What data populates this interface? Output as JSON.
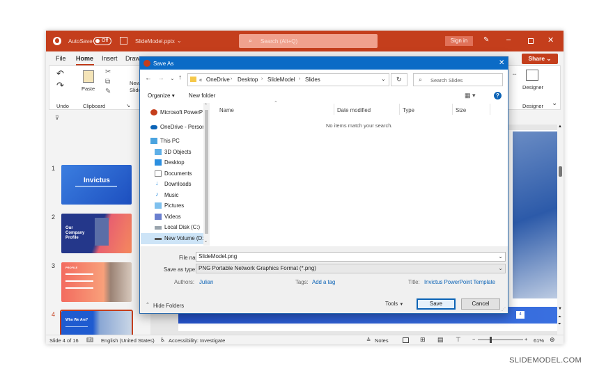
{
  "titlebar": {
    "autosave": "AutoSave",
    "toggle": "Off",
    "filename": "SlideModel.pptx",
    "search_placeholder": "Search (Alt+Q)",
    "signin": "Sign in"
  },
  "tabs": [
    "File",
    "Home",
    "Insert",
    "Draw"
  ],
  "share": "Share",
  "ribbon": {
    "undo": "Undo",
    "clipboard": "Clipboard",
    "paste": "Paste",
    "new_slide_1": "New",
    "new_slide_2": "Slide",
    "designer": "Designer",
    "designer_group": "Designer"
  },
  "slides": [
    {
      "num": "1",
      "title": "Invictus"
    },
    {
      "num": "2",
      "title": "Our Company Profile"
    },
    {
      "num": "3",
      "title": "PROFILE"
    },
    {
      "num": "4",
      "title": "Who We Are?"
    },
    {
      "num": "5",
      "title": ""
    }
  ],
  "status": {
    "slide": "Slide 4 of 16",
    "language": "English (United States)",
    "accessibility": "Accessibility: Investigate",
    "notes": "Notes",
    "zoom": "61%"
  },
  "slide_badge": "4",
  "dialog": {
    "title": "Save As",
    "breadcrumb": [
      "OneDrive",
      "Desktop",
      "SlideModel",
      "Slides"
    ],
    "breadcrumb_prefix": "«",
    "search_placeholder": "Search Slides",
    "organize": "Organize",
    "new_folder": "New folder",
    "tree": [
      "Microsoft PowerP",
      "OneDrive - Person",
      "This PC",
      "3D Objects",
      "Desktop",
      "Documents",
      "Downloads",
      "Music",
      "Pictures",
      "Videos",
      "Local Disk (C:)",
      "New Volume (D:"
    ],
    "columns": [
      "Name",
      "Date modified",
      "Type",
      "Size"
    ],
    "empty_message": "No items match your search.",
    "file_name_label": "File name:",
    "file_name": "SlideModel.png",
    "save_type_label": "Save as type:",
    "save_type": "PNG Portable Network Graphics Format (*.png)",
    "authors_label": "Authors:",
    "authors": "Julian",
    "tags_label": "Tags:",
    "tags": "Add a tag",
    "title_label": "Title:",
    "title_value": "Invictus PowerPoint Template",
    "hide_folders": "Hide Folders",
    "tools": "Tools",
    "save": "Save",
    "cancel": "Cancel"
  },
  "watermark": "SLIDEMODEL.COM",
  "colors": {
    "accent": "#c43e1c",
    "dialog_title": "#0b6bc6",
    "link": "#0b63b6"
  }
}
